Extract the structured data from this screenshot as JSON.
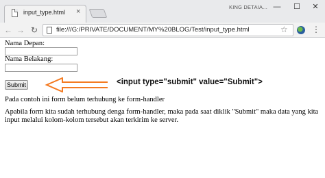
{
  "browser": {
    "tab_title": "input_type.html",
    "tab_close": "×",
    "user_name": "KING DETAIA...",
    "window_controls": {
      "minimize": "—",
      "maximize": "☐",
      "close": "✕"
    },
    "nav": {
      "back": "←",
      "forward": "→",
      "reload": "↻"
    },
    "url": "file:///G:/PRIVATE/DOCUMENT/MY%20BLOG/Test/input_type.html",
    "star": "☆",
    "menu": "⋮"
  },
  "form": {
    "first_name_label": "Nama Depan:",
    "first_name_value": "",
    "last_name_label": "Nama Belakang:",
    "last_name_value": "",
    "submit_label": "Submit"
  },
  "annotation": {
    "text": "<input type=\"submit\" value=\"Submit\">",
    "arrow_color": "#f47a20"
  },
  "page_text": {
    "note": "Pada contoh ini form belum terhubung ke form-handler",
    "paragraph": "Apabila form kita sudah terhubung denga form-handler, maka pada saat diklik \"Submit\" maka data yang kita input melalui kolom-kolom tersebut akan terkirim ke server."
  }
}
